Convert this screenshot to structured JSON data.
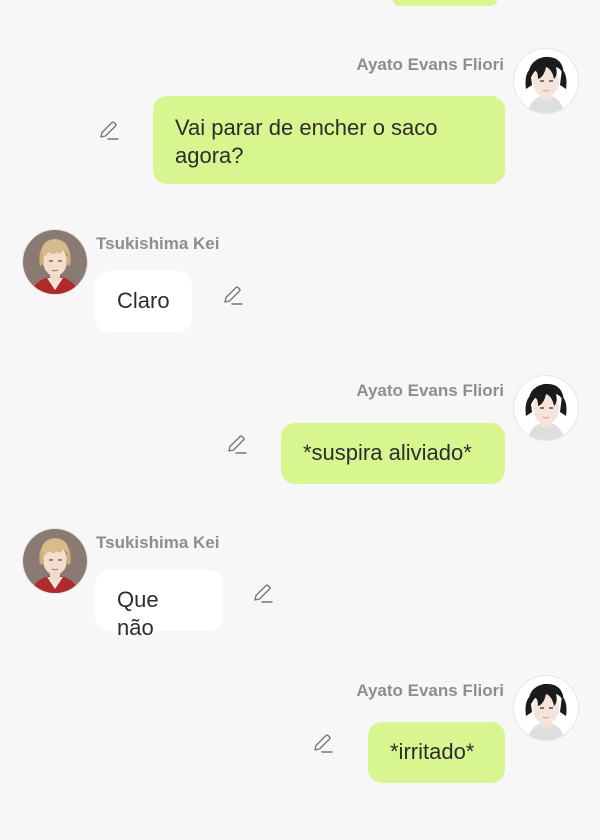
{
  "messages": [
    {
      "sender": "Ayato Evans Fliori",
      "direction": "out",
      "text": "Vai parar de encher o saco agora?"
    },
    {
      "sender": "Tsukishima Kei",
      "direction": "in",
      "text": "Claro"
    },
    {
      "sender": "Ayato Evans Fliori",
      "direction": "out",
      "text": "*suspira aliviado*"
    },
    {
      "sender": "Tsukishima Kei",
      "direction": "in",
      "text": "Que não"
    },
    {
      "sender": "Ayato Evans Fliori",
      "direction": "out",
      "text": "*irritado*"
    }
  ],
  "icons": {
    "edit": "pencil-edit-icon",
    "avatar_ayato": "avatar-ayato",
    "avatar_kei": "avatar-tsukishima-kei"
  },
  "colors": {
    "background": "#f7f7f7",
    "outgoing_bubble": "#d7f68f",
    "incoming_bubble": "#ffffff",
    "sender_name": "#8e8e8e",
    "message_text": "#2d2d2d"
  }
}
